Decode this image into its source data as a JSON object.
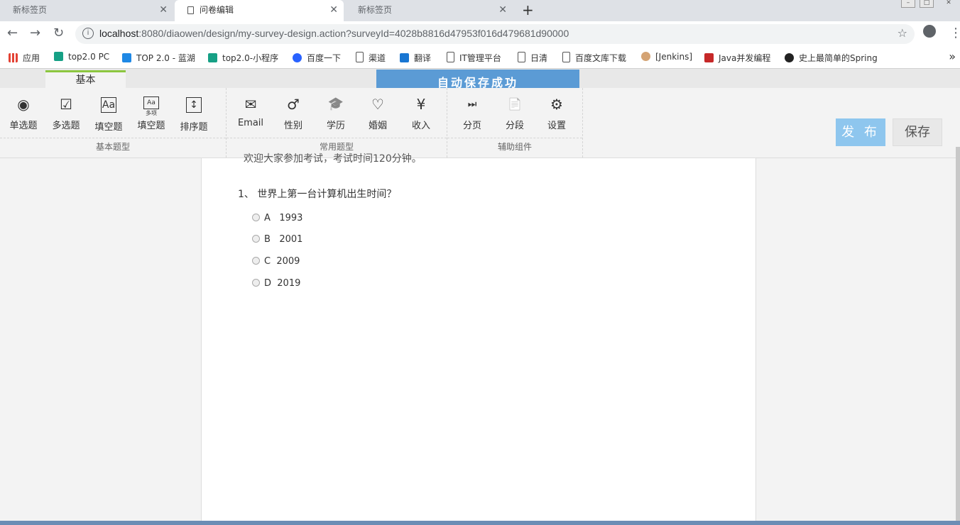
{
  "browser": {
    "tabs": [
      {
        "label": "新标签页"
      },
      {
        "label": "问卷编辑"
      },
      {
        "label": "新标签页"
      }
    ],
    "new_tab": "+",
    "close_glyph": "✕",
    "url_host": "localhost",
    "url_rest": ":8080/diaowen/design/my-survey-design.action?surveyId=4028b8816d47953f016d479681d90000"
  },
  "bookmarks": [
    {
      "label": "应用",
      "icon": "apps-grid-icon",
      "color": "#e34234"
    },
    {
      "label": "top2.0 PC",
      "icon": "play-icon",
      "color": "#16a085"
    },
    {
      "label": "TOP 2.0 - 蓝湖",
      "icon": "lanhu-icon",
      "color": "#1e88e5"
    },
    {
      "label": "top2.0-小程序",
      "icon": "play-icon",
      "color": "#16a085"
    },
    {
      "label": "百度一下",
      "icon": "baidu-paw-icon",
      "color": "#2962ff"
    },
    {
      "label": "渠道",
      "icon": "page-icon",
      "color": "#ffffff"
    },
    {
      "label": "翻译",
      "icon": "translate-icon",
      "color": "#1976d2"
    },
    {
      "label": "IT管理平台",
      "icon": "page-icon",
      "color": "#ffffff"
    },
    {
      "label": "日清",
      "icon": "page-icon",
      "color": "#ffffff"
    },
    {
      "label": "百度文库下载",
      "icon": "page-icon",
      "color": "#ffffff"
    },
    {
      "label": "[Jenkins]",
      "icon": "jenkins-icon",
      "color": "#d4a373"
    },
    {
      "label": "Java并发编程",
      "icon": "csdn-icon",
      "color": "#c62828"
    },
    {
      "label": "史上最简单的Spring",
      "icon": "github-icon",
      "color": "#222222"
    }
  ],
  "ribbon": {
    "tab_label": "基本",
    "autosave": "自动保存成功",
    "publish": "发 布",
    "save": "保存",
    "groups": [
      {
        "label": "基本题型",
        "tools": [
          {
            "label": "单选题",
            "icon": "radio-icon",
            "glyph": "◉"
          },
          {
            "label": "多选题",
            "icon": "checkbox-icon",
            "glyph": "☑"
          },
          {
            "label": "填空题",
            "icon": "text-input-icon",
            "glyph": "Aa"
          },
          {
            "label": "填空题",
            "icon": "multi-text-input-icon",
            "glyph": "Aa",
            "sub": "多项"
          },
          {
            "label": "排序题",
            "icon": "sort-icon",
            "glyph": "↕"
          }
        ]
      },
      {
        "label": "常用题型",
        "tools": [
          {
            "label": "Email",
            "icon": "email-icon",
            "glyph": "✉"
          },
          {
            "label": "性别",
            "icon": "gender-icon",
            "glyph": "♂"
          },
          {
            "label": "学历",
            "icon": "graduation-cap-icon",
            "glyph": "🎓"
          },
          {
            "label": "婚姻",
            "icon": "heart-icon",
            "glyph": "♡"
          },
          {
            "label": "收入",
            "icon": "yen-icon",
            "glyph": "¥"
          }
        ]
      },
      {
        "label": "辅助组件",
        "tools": [
          {
            "label": "分页",
            "icon": "page-break-icon",
            "glyph": "⏭"
          },
          {
            "label": "分段",
            "icon": "section-icon",
            "glyph": "📄"
          },
          {
            "label": "设置",
            "icon": "settings-icon",
            "glyph": "⚙"
          }
        ]
      }
    ]
  },
  "survey": {
    "intro": "欢迎大家参加考试，考试时间120分钟。",
    "question": "1、 世界上第一台计算机出生时间？",
    "options": [
      {
        "letter": "A",
        "text": "1993"
      },
      {
        "letter": "B",
        "text": "2001"
      },
      {
        "letter": "C",
        "text": "2009"
      },
      {
        "letter": "D",
        "text": "2019"
      }
    ]
  }
}
